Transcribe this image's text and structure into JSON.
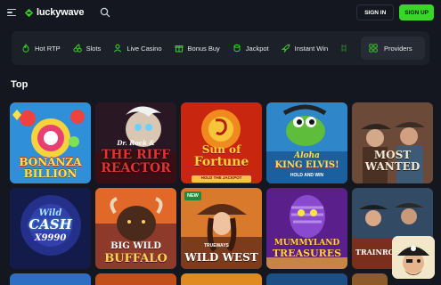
{
  "header": {
    "logo_text": "luckywave",
    "signin_label": "SIGN IN",
    "signup_label": "SIGN UP"
  },
  "categories": [
    {
      "label": "Hot RTP",
      "icon": "flame-icon"
    },
    {
      "label": "Slots",
      "icon": "cherries-icon"
    },
    {
      "label": "Live Casino",
      "icon": "live-user-icon"
    },
    {
      "label": "Bonus Buy",
      "icon": "gift-icon"
    },
    {
      "label": "Jackpot",
      "icon": "coins-icon"
    },
    {
      "label": "Instant Win",
      "icon": "rocket-icon"
    }
  ],
  "providers_label": "Providers",
  "section_title": "Top",
  "games": [
    {
      "lines": [
        "BONANZA",
        "BILLION"
      ]
    },
    {
      "lines": [
        "Dr. Rock &",
        "THE RIFF",
        "REACTOR"
      ]
    },
    {
      "lines": [
        "Sun of",
        "Fortune",
        "HOLD THE JACKPOT"
      ]
    },
    {
      "lines": [
        "Aloha",
        "KING ELVIS!",
        "HOLD AND WIN"
      ]
    },
    {
      "lines": [
        "MOST",
        "WANTED"
      ]
    },
    {
      "lines": [
        "Wild",
        "CASH",
        "X9990"
      ]
    },
    {
      "lines": [
        "BIG WILD",
        "BUFFALO"
      ]
    },
    {
      "badge": "NEW",
      "lines": [
        "TRUEWAYS",
        "WILD WEST"
      ]
    },
    {
      "lines": [
        "MUMMYLAND",
        "TREASURES"
      ]
    },
    {
      "lines": [
        "TRAIN",
        "ROBBE"
      ]
    }
  ],
  "colors": {
    "accent": "#38d626",
    "background": "#14171f",
    "panel": "#1c2029"
  }
}
